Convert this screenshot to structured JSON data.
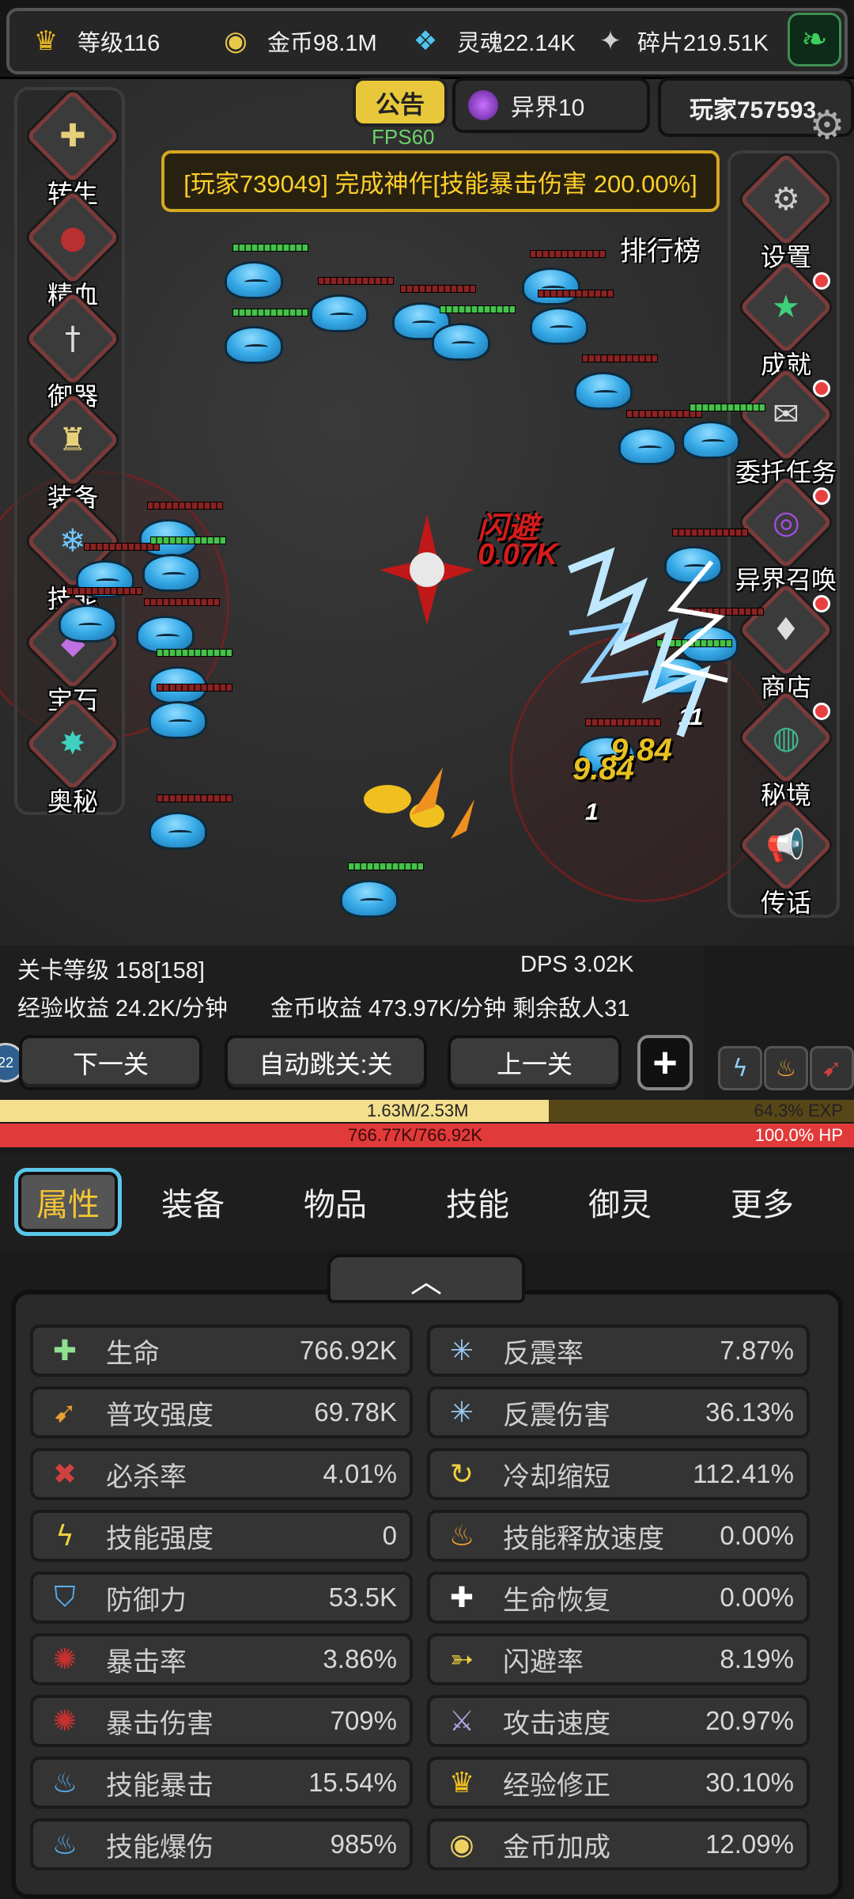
{
  "resources": [
    {
      "icon": "crown-icon",
      "glyph": "♛",
      "color": "#e8b820",
      "label": "等级116"
    },
    {
      "icon": "coin-icon",
      "glyph": "◉",
      "color": "#e8c84a",
      "label": "金币98.1M"
    },
    {
      "icon": "soul-icon",
      "glyph": "❖",
      "color": "#4fc4f0",
      "label": "灵魂22.14K"
    },
    {
      "icon": "shard-icon",
      "glyph": "✦",
      "color": "#d0d0d0",
      "label": "碎片219.51K"
    }
  ],
  "header": {
    "notice": "公告",
    "world": "异界10",
    "player": "玩家757593",
    "fps": "FPS60"
  },
  "banner": "[玩家739049] 完成神作[技能暴击伤害 200.00%]",
  "left_menu": [
    {
      "label": "转生",
      "glyph": "✚",
      "color": "#e6d07a"
    },
    {
      "label": "精血",
      "glyph": "●",
      "color": "#b83030"
    },
    {
      "label": "御器",
      "glyph": "†",
      "color": "#ddd"
    },
    {
      "label": "装备",
      "glyph": "♜",
      "color": "#e8d07a"
    },
    {
      "label": "技能",
      "glyph": "❄",
      "color": "#6fc8ff"
    },
    {
      "label": "宝石",
      "glyph": "◆",
      "color": "#c070e0"
    },
    {
      "label": "奥秘",
      "glyph": "✸",
      "color": "#3fd0c0"
    }
  ],
  "right_menu": [
    {
      "label": "设置",
      "glyph": "⚙",
      "color": "#ccc",
      "dot": false
    },
    {
      "label": "成就",
      "glyph": "★",
      "color": "#3fd07a",
      "dot": true
    },
    {
      "label": "委托任务",
      "glyph": "✉",
      "color": "#ddd",
      "dot": true
    },
    {
      "label": "异界召唤",
      "glyph": "◎",
      "color": "#a050e0",
      "dot": true
    },
    {
      "label": "商店",
      "glyph": "♦",
      "color": "#ddd",
      "dot": true
    },
    {
      "label": "秘境",
      "glyph": "◍",
      "color": "#3fb08a",
      "dot": true
    },
    {
      "label": "传话",
      "glyph": "📢",
      "color": "#3fd07a",
      "dot": false
    }
  ],
  "rank_label": "排行榜",
  "combat": {
    "flash_label": "闪避",
    "flash_value": "0.07K",
    "dmg1": "9.84",
    "dmg2": "9.84",
    "dmg3": "11",
    "dmg4": "1"
  },
  "stage": {
    "level": "关卡等级 158[158]",
    "dps": "DPS 3.02K",
    "exp_rate": "经验收益 24.2K/分钟",
    "gold_rate": "金币收益 473.97K/分钟 剩余敌人31",
    "next": "下一关",
    "auto": "自动跳关:关",
    "prev": "上一关",
    "plus": "+",
    "lvl_badge": "22"
  },
  "exp": {
    "text": "1.63M/2.53M",
    "pct": "64.3% EXP",
    "fraction": 0.643
  },
  "hp": {
    "text": "766.77K/766.92K",
    "pct": "100.0%  HP",
    "fraction": 1.0
  },
  "tabs": [
    "属性",
    "装备",
    "物品",
    "技能",
    "御灵",
    "更多"
  ],
  "toggle_glyph": "︿",
  "stats_left": [
    {
      "name": "生命",
      "value": "766.92K",
      "glyph": "✚",
      "color": "#8fe08f"
    },
    {
      "name": "普攻强度",
      "value": "69.78K",
      "glyph": "➹",
      "color": "#e8a030"
    },
    {
      "name": "必杀率",
      "value": "4.01%",
      "glyph": "✖",
      "color": "#d04040"
    },
    {
      "name": "技能强度",
      "value": "0",
      "glyph": "ϟ",
      "color": "#f0d040"
    },
    {
      "name": "防御力",
      "value": "53.5K",
      "glyph": "⛉",
      "color": "#5ab0f0"
    },
    {
      "name": "暴击率",
      "value": "3.86%",
      "glyph": "✺",
      "color": "#c83030"
    },
    {
      "name": "暴击伤害",
      "value": "709%",
      "glyph": "✺",
      "color": "#c83030"
    },
    {
      "name": "技能暴击",
      "value": "15.54%",
      "glyph": "♨",
      "color": "#5ab0f0"
    },
    {
      "name": "技能爆伤",
      "value": "985%",
      "glyph": "♨",
      "color": "#5ab0f0"
    }
  ],
  "stats_right": [
    {
      "name": "反震率",
      "value": "7.87%",
      "glyph": "✳",
      "color": "#9ac8f0"
    },
    {
      "name": "反震伤害",
      "value": "36.13%",
      "glyph": "✳",
      "color": "#9ac8f0"
    },
    {
      "name": "冷却缩短",
      "value": "112.41%",
      "glyph": "↻",
      "color": "#f0d040"
    },
    {
      "name": "技能释放速度",
      "value": "0.00%",
      "glyph": "♨",
      "color": "#f0a030"
    },
    {
      "name": "生命恢复",
      "value": "0.00%",
      "glyph": "✚",
      "color": "#ffffff"
    },
    {
      "name": "闪避率",
      "value": "8.19%",
      "glyph": "➳",
      "color": "#f0d040"
    },
    {
      "name": "攻击速度",
      "value": "20.97%",
      "glyph": "⚔",
      "color": "#b0a0e0"
    },
    {
      "name": "经验修正",
      "value": "30.10%",
      "glyph": "♛",
      "color": "#f0c020"
    },
    {
      "name": "金币加成",
      "value": "12.09%",
      "glyph": "◉",
      "color": "#f0d060"
    }
  ]
}
